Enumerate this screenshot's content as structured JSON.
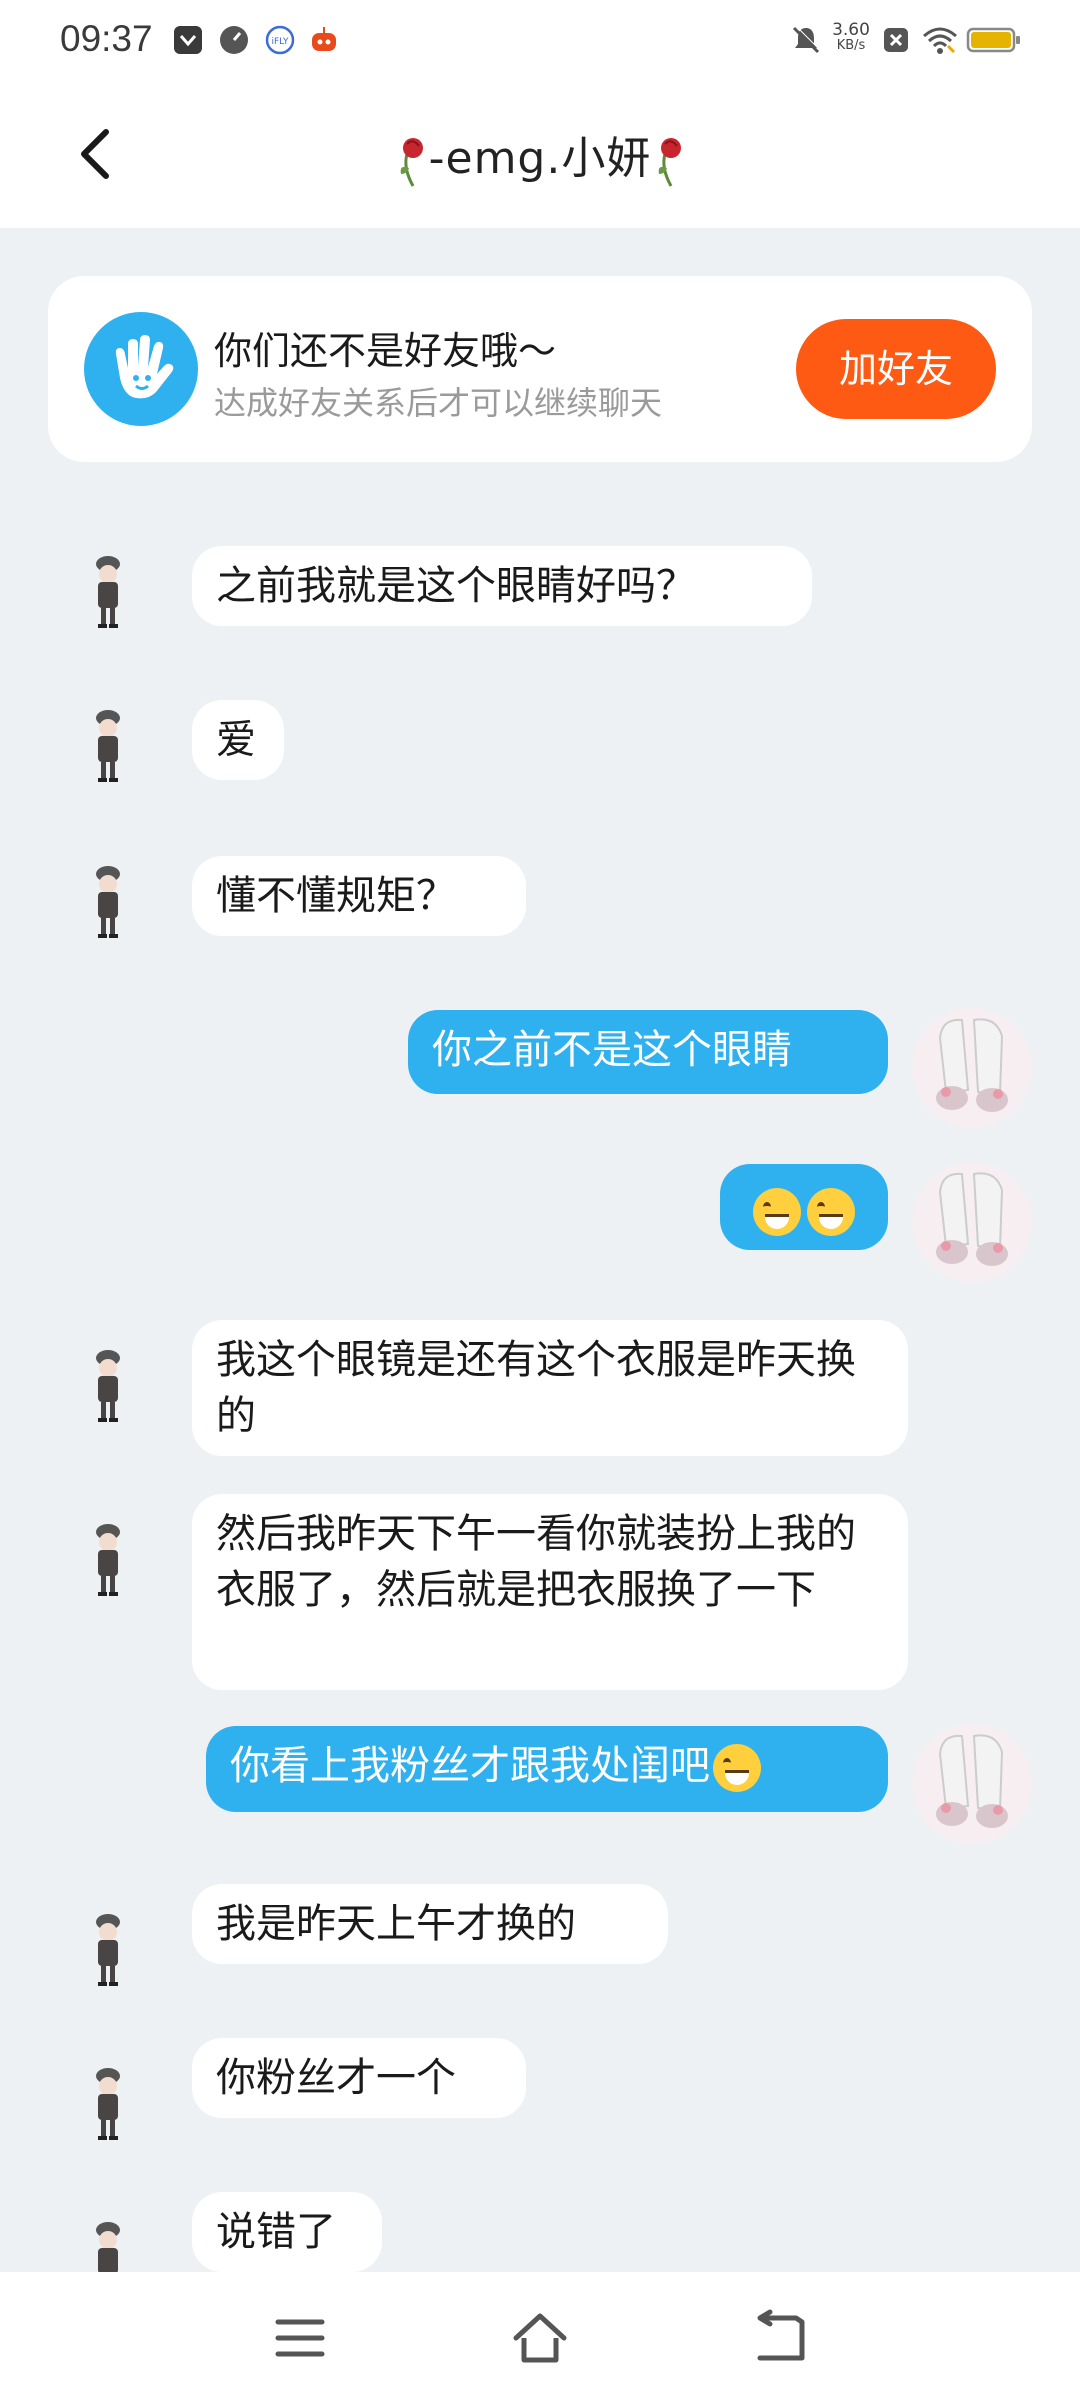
{
  "status_bar": {
    "time": "09:37",
    "net_speed_value": "3.60",
    "net_speed_unit": "KB/s",
    "icons": [
      "app-icon",
      "compass-icon",
      "iflytek-icon",
      "bot-icon",
      "mute-icon",
      "close-box-icon",
      "wifi-icon",
      "battery-icon"
    ]
  },
  "header": {
    "title": "-emg.小妍",
    "back_icon": "chevron-left-icon"
  },
  "friend_banner": {
    "title": "你们还不是好友哦～",
    "subtitle": "达成好友关系后才可以继续聊天",
    "button": "加好友",
    "button_color": "#ff5a14"
  },
  "messages": [
    {
      "side": "in",
      "text": "之前我就是这个眼睛好吗？"
    },
    {
      "side": "in",
      "text": "爱"
    },
    {
      "side": "in",
      "text": "懂不懂规矩？"
    },
    {
      "side": "out",
      "text": "你之前不是这个眼睛"
    },
    {
      "side": "out",
      "text": "",
      "emoji": [
        "grinning-sweat-emoji",
        "grinning-sweat-emoji"
      ]
    },
    {
      "side": "in",
      "text": "我这个眼镜是还有这个衣服是昨天换的"
    },
    {
      "side": "in",
      "text": "然后我昨天下午一看你就装扮上我的衣服了，然后就是把衣服换了一下"
    },
    {
      "side": "out",
      "text": "你看上我粉丝才跟我处闺吧",
      "emoji": [
        "grinning-sweat-emoji"
      ]
    },
    {
      "side": "in",
      "text": "我是昨天上午才换的"
    },
    {
      "side": "in",
      "text": "你粉丝才一个"
    },
    {
      "side": "in",
      "text": "说错了"
    }
  ],
  "colors": {
    "outgoing_bubble": "#2fb1ef",
    "incoming_bubble": "#ffffff",
    "background": "#eef1f4"
  },
  "bottom_nav": [
    "menu-icon",
    "home-icon",
    "back-icon"
  ]
}
